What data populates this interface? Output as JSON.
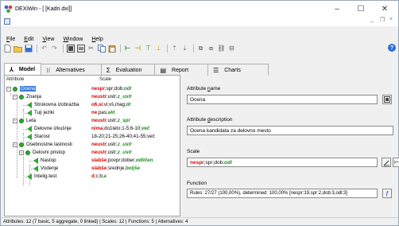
{
  "window": {
    "title": "DEXiWin - [ [Kadri.dxi]]",
    "minimize": "–",
    "maximize": "☐",
    "close": "✕",
    "mdi_min": "_",
    "mdi_restore": "❐",
    "mdi_close": "×"
  },
  "menu": [
    {
      "label": "File",
      "u": "F",
      "rest": "ile"
    },
    {
      "label": "Edit",
      "u": "E",
      "rest": "dit"
    },
    {
      "label": "View",
      "u": "V",
      "rest": "iew"
    },
    {
      "label": "Window",
      "u": "W",
      "rest": "indow"
    },
    {
      "label": "Help",
      "u": "H",
      "rest": "elp"
    }
  ],
  "tabs": {
    "model": "Model",
    "alternatives": "Alternatives",
    "evaluation": "Evaluation",
    "report": "Report",
    "charts": "Charts"
  },
  "tree": {
    "col_attribute": "Attribute",
    "col_scale": "Scale",
    "rows": [
      {
        "label": "Ocena",
        "scale_red": "nespr",
        "scale_mid": ";spr;dob;",
        "scale_grn": "odl"
      },
      {
        "label": "Znanja",
        "scale_red": "neustr",
        "scale_mid": ";ustr;",
        "scale_grn": "z_ustr"
      },
      {
        "label": "Strokovna izobrazba",
        "scale_red": "o6,si",
        "scale_mid": ";vi;vš,mag;",
        "scale_grn": "dr"
      },
      {
        "label": "Tuji jeziki",
        "scale_red": "ne",
        "scale_mid": ";pas;",
        "scale_grn": "akt"
      },
      {
        "label": "Leta",
        "scale_red": "neustr",
        "scale_mid": ";ustr;",
        "scale_grn": "z_spr"
      },
      {
        "label": "Delovne izkušnje",
        "scale_red": "nima",
        "scale_mid": ";do1leto;1-5;6-10;",
        "scale_grn": "več"
      },
      {
        "label": "Starost",
        "scale_red": "",
        "scale_mid": "18-20;21-25;26-40;41-55;več",
        "scale_grn": ""
      },
      {
        "label": "Osebnostne lastnosti",
        "scale_red": "neustr",
        "scale_mid": ";ustr;",
        "scale_grn": "z_ustr"
      },
      {
        "label": "Delovni pristop",
        "scale_red": "neustr",
        "scale_mid": ";ustr;",
        "scale_grn": "z_ustr"
      },
      {
        "label": "Nastop",
        "scale_red": "slabše",
        "scale_mid": ";povpr;dober;",
        "scale_grn": "odličen"
      },
      {
        "label": "Vodenje",
        "scale_red": "slabše",
        "scale_mid": ";srednje;",
        "scale_grn": "boljše"
      },
      {
        "label": "Intelig.test",
        "scale_red": "d",
        "scale_mid": ";c;b;",
        "scale_grn": "a"
      }
    ]
  },
  "details": {
    "name_label_pre": "Attribute ",
    "name_label_u": "n",
    "name_label_post": "ame",
    "name_value": "Ocena",
    "desc_label_pre": "Attribute ",
    "desc_label_u": "d",
    "desc_label_post": "escription",
    "desc_value": "Ocena kandidata za delovno mesto",
    "scale_label": "Scale",
    "scale_red": "nespr",
    "scale_mid": ";spr;dob;",
    "scale_grn": "odl",
    "function_label": "Function",
    "function_value": "Rules: 27/27 (100,00%), determined: 100,00% [nespr:19,spr:2,dob:3,odl:3]"
  },
  "status": "Attributes: 12 (7 basic, 5 aggregate, 0 linked) | Scales: 12 | Functions: 5 | Alternatives: 4",
  "colors": {
    "selection": "#3a7bd5",
    "scale_bad": "#e00000",
    "scale_good": "#1a8f1a",
    "node": "#2fa82f"
  }
}
